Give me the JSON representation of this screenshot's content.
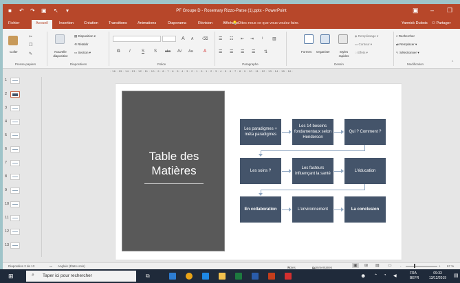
{
  "titlebar": {
    "title": "PF Groupe D - Rosemary Rizzo-Parse (1).pptx - PowerPoint",
    "min": "–",
    "restore": "❐",
    "opts": "▣"
  },
  "tabs": {
    "file": "Fichier",
    "home": "Accueil",
    "insert": "Insertion",
    "design": "Création",
    "transitions": "Transitions",
    "animations": "Animations",
    "slideshow": "Diaporama",
    "review": "Révision",
    "view": "Affichage",
    "tellme": "Dites-nous ce que vous voulez faire.",
    "user": "Yannick Dubois",
    "share": "Partager"
  },
  "ribbon": {
    "paste": "Coller",
    "new_slide": "Nouvelle diapositive",
    "layout": "Disposition",
    "reset": "Rétablir",
    "section": "Section",
    "group_clipboard": "Presse-papiers",
    "group_slides": "Diapositives",
    "group_font": "Police",
    "group_paragraph": "Paragraphe",
    "group_drawing": "Dessin",
    "group_editing": "Modification",
    "font_size_grow": "A",
    "font_size_shrink": "A",
    "bold": "G",
    "italic": "I",
    "underline": "S",
    "strike": "S",
    "abc": "abc",
    "spacing": "AV",
    "case": "Aa",
    "font_color": "A",
    "shapes": "Formes",
    "arrange": "Organiser",
    "quick_styles": "Styles rapides",
    "fill": "Remplissage",
    "outline": "Contour",
    "effects": "Effets",
    "find": "Rechercher",
    "replace": "Remplacer",
    "select": "Sélectionner"
  },
  "ruler": "· 16 · 15 · 14 · 13 · 12 · 11 · 10 · 9 · 8 · 7 · 6 · 5 · 4 · 3 · 2 · 1 · 0 · 1 · 2 · 3 · 4 · 5 · 6 · 7 · 8 · 9 · 10 · 11 · 12 · 13 · 14 · 15 · 16 ·",
  "thumbnails": [
    "1",
    "2",
    "3",
    "4",
    "5",
    "6",
    "7",
    "8",
    "9",
    "10",
    "11",
    "12",
    "13"
  ],
  "slide": {
    "toc_title_line1": "Table des",
    "toc_title_line2": "Matières",
    "boxes": {
      "r1c1": "Les paradigmes + méta paradigmes",
      "r1c2": "Les 14 besoins fondamentaux selon Henderson",
      "r1c3": "Qui ? Comment ?",
      "r2c1": "Les soins ?",
      "r2c2": "Les facteurs influençant la santé",
      "r2c3": "L'éducation",
      "r3c1": "En collaboration",
      "r3c2": "L'environnement",
      "r3c3": "La conclusion"
    }
  },
  "status": {
    "slide_count": "Diapositive 2 de 13",
    "language": "Anglais (États-Unis)",
    "notes": "Notes",
    "comments": "Commentaires",
    "zoom": "67 %",
    "zoom_minus": "-",
    "zoom_plus": "+"
  },
  "taskbar": {
    "search_placeholder": "Taper ici pour rechercher",
    "lang": "FRA",
    "lang2": "BEFR",
    "time": "09:33",
    "date": "13/12/2019"
  },
  "colors": {
    "accent": "#b7472a",
    "box": "#44546a",
    "toc": "#595959"
  }
}
